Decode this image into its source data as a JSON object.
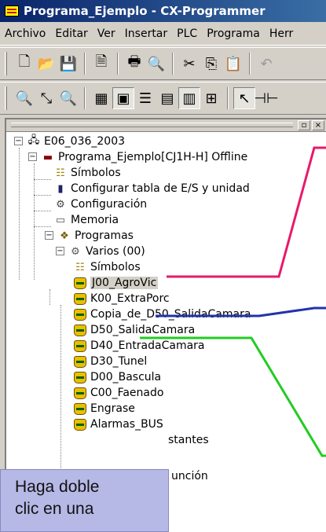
{
  "window": {
    "title": "Programa_Ejemplo - CX-Programmer"
  },
  "menu": [
    "Archivo",
    "Editar",
    "Ver",
    "Insertar",
    "PLC",
    "Programa",
    "Herr"
  ],
  "tree": {
    "root": "E06_036_2003",
    "project": "Programa_Ejemplo[CJ1H-H] Offline",
    "simbolos": "Símbolos",
    "tabla_es": "Configurar tabla de E/S y unidad",
    "configuracion": "Configuración",
    "memoria": "Memoria",
    "programas": "Programas",
    "varios": "Varios (00)",
    "varios_simbolos": "Símbolos",
    "sections": [
      "J00_AgroVic",
      "K00_ExtraPorc",
      "Copia_de_D50_SalidaCamara",
      "D50_SalidaCamara",
      "D40_EntradaCamara",
      "D30_Tunel",
      "D00_Bascula",
      "C00_Faenado",
      "Engrase",
      "Alarmas_BUS"
    ],
    "partial_1": "stantes",
    "partial_2": "unción"
  },
  "callout": {
    "line1": "Haga doble",
    "line2": "clic en una"
  },
  "colors": {
    "pink": "#e8196b",
    "blue": "#2233aa",
    "green": "#22cc22"
  }
}
